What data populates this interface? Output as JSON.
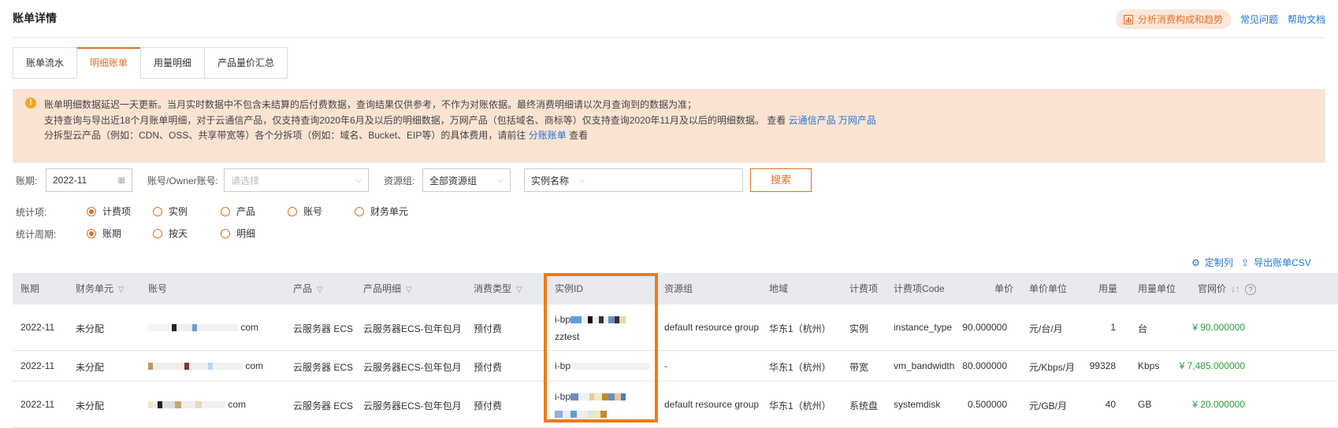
{
  "header": {
    "title": "账单详情",
    "analyze": "分析消费构成和趋势",
    "faq": "常见问题",
    "help": "帮助文档"
  },
  "tabs": [
    {
      "label": "账单流水"
    },
    {
      "label": "明细账单"
    },
    {
      "label": "用量明细"
    },
    {
      "label": "产品量价汇总"
    }
  ],
  "notice": {
    "line1": "账单明细数据延迟一天更新。当月实时数据中不包含未结算的后付费数据，查询结果仅供参考，不作为对账依据。最终消费明细请以次月查询到的数据为准；",
    "line2_pre": "支持查询与导出近18个月账单明细，对于云通信产品，仅支持查询2020年6月及以后的明细数据，万网产品（包括域名、商标等）仅支持查询2020年11月及以后的明细数据。 查看",
    "link_cloud": "云通信产品",
    "link_wanwang": "万网产品",
    "line3_pre": "分拆型云产品（例如：CDN、OSS、共享带宽等）各个分拆项（例如：域名、Bucket、EIP等）的具体费用，请前往",
    "link_split": "分账账单",
    "line3_post": "查看"
  },
  "filters": {
    "period_label": "账期:",
    "period_value": "2022-11",
    "account_label": "账号/Owner账号:",
    "account_placeholder": "请选择",
    "group_label": "资源组:",
    "group_value": "全部资源组",
    "instance_select": "实例名称",
    "search_btn": "搜索"
  },
  "stat_item": {
    "label": "统计项:",
    "options": [
      "计费项",
      "实例",
      "产品",
      "账号",
      "财务单元"
    ],
    "selected": 0
  },
  "stat_period": {
    "label": "统计周期:",
    "options": [
      "账期",
      "按天",
      "明细"
    ],
    "selected": 0
  },
  "tools": {
    "customize": "定制列",
    "export": "导出账单CSV"
  },
  "table": {
    "headers": [
      "账期",
      "财务单元",
      "账号",
      "产品",
      "产品明细",
      "消费类型",
      "实例ID",
      "资源组",
      "地域",
      "计费项",
      "计费项Code",
      "单价",
      "单价单位",
      "用量",
      "用量单位",
      "官网价"
    ],
    "rows": [
      {
        "period": "2022-11",
        "unit": "未分配",
        "account_suffix": "com",
        "product": "云服务器 ECS",
        "product_detail": "云服务器ECS-包年包月",
        "type": "预付费",
        "instance_prefix": "i-bp",
        "instance_line2": "zztest",
        "group": "default resource group",
        "region": "华东1（杭州）",
        "item": "实例",
        "code": "instance_type",
        "price": "90.000000",
        "price_unit": "元/台/月",
        "usage": "1",
        "usage_unit": "台",
        "list_price": "¥ 90.000000"
      },
      {
        "period": "2022-11",
        "unit": "未分配",
        "account_suffix": "com",
        "product": "云服务器 ECS",
        "product_detail": "云服务器ECS-包年包月",
        "type": "预付费",
        "instance_prefix": "i-bp",
        "instance_line2": "",
        "group": "-",
        "region": "华东1（杭州）",
        "item": "带宽",
        "code": "vm_bandwidth",
        "price": "80.000000",
        "price_unit": "元/Kbps/月",
        "usage": "99328",
        "usage_unit": "Kbps",
        "list_price": "¥ 7,485.000000"
      },
      {
        "period": "2022-11",
        "unit": "未分配",
        "account_suffix": "com",
        "product": "云服务器 ECS",
        "product_detail": "云服务器ECS-包年包月",
        "type": "预付费",
        "instance_prefix": "i-bp",
        "instance_line2": "",
        "group": "default resource group",
        "region": "华东1（杭州）",
        "item": "系统盘",
        "code": "systemdisk",
        "price": "0.500000",
        "price_unit": "元/GB/月",
        "usage": "40",
        "usage_unit": "GB",
        "list_price": "¥ 20.000000"
      }
    ]
  },
  "colors": {
    "accent": "#e07024",
    "link": "#1f76d6",
    "notice_bg": "#fbe3d3",
    "price": "#2a9d3a",
    "highlight": "#f07a18"
  }
}
